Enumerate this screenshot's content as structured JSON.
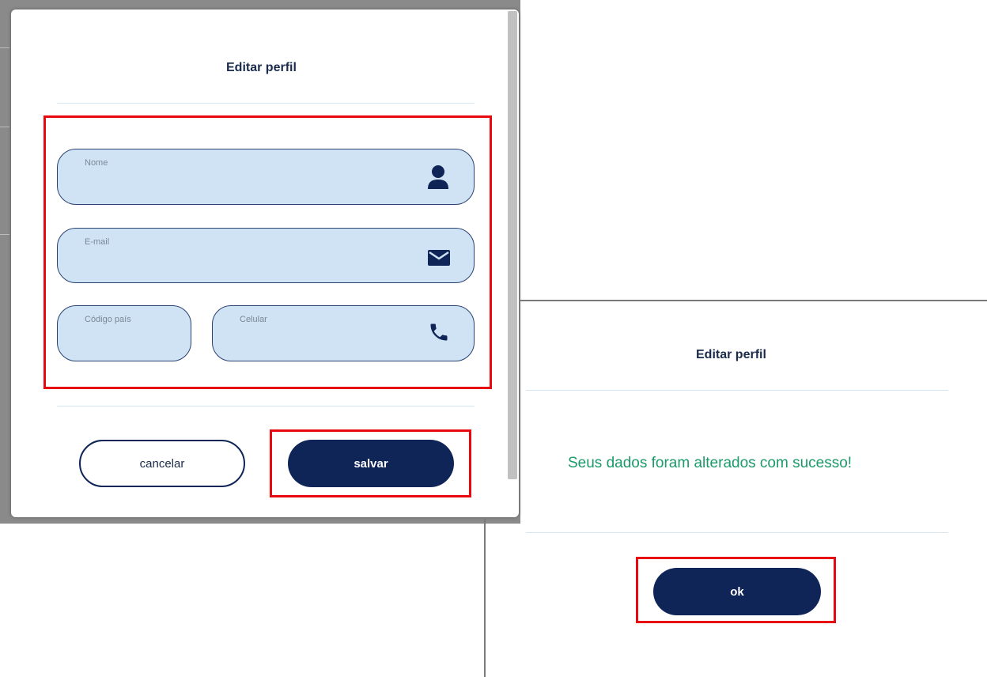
{
  "left_modal": {
    "title": "Editar perfil",
    "fields": {
      "nome": {
        "label": "Nome",
        "value": ""
      },
      "email": {
        "label": "E-mail",
        "value": ""
      },
      "codigo_pais": {
        "label": "Código país",
        "value": ""
      },
      "celular": {
        "label": "Celular",
        "value": ""
      }
    },
    "buttons": {
      "cancel": "cancelar",
      "save": "salvar"
    }
  },
  "right_dialog": {
    "title": "Editar perfil",
    "message": "Seus dados foram alterados com sucesso!",
    "ok": "ok"
  },
  "colors": {
    "field_bg": "#cfe3f5",
    "field_border": "#2a4270",
    "primary": "#0f2457",
    "success_text": "#1b9a6a",
    "highlight": "#e8080f"
  },
  "icons": [
    "user-icon",
    "envelope-icon",
    "phone-icon"
  ]
}
